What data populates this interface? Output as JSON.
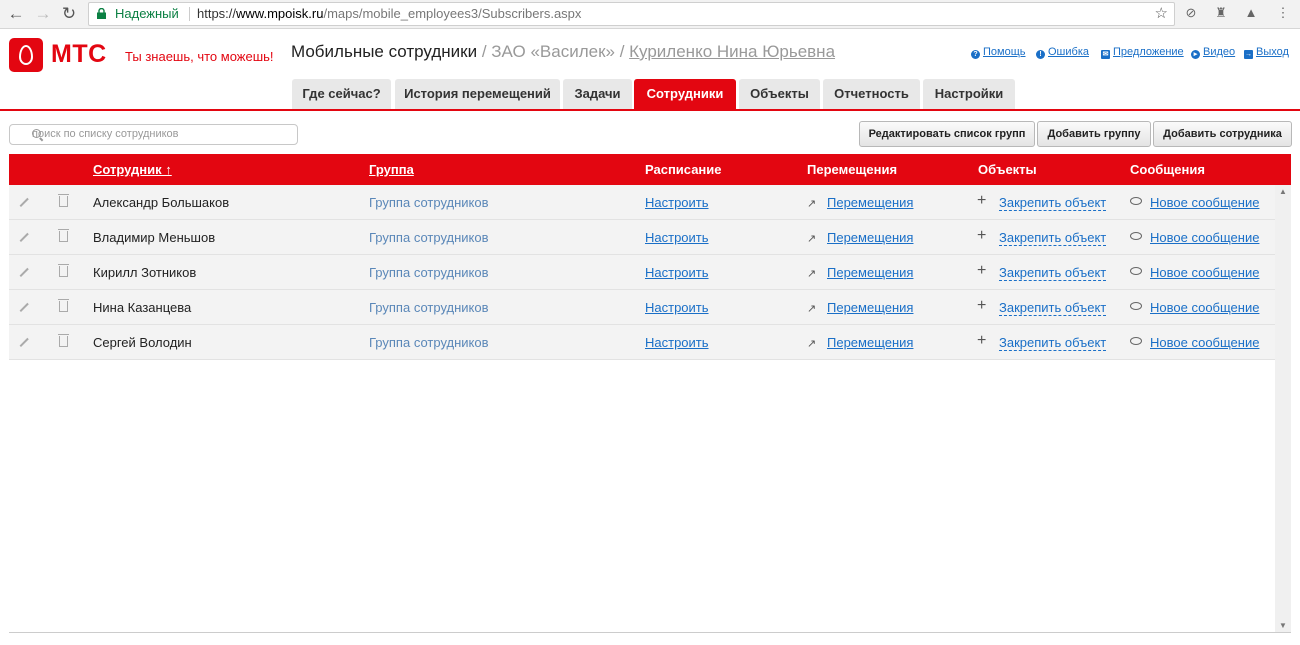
{
  "browser": {
    "secure_label": "Надежный",
    "url_scheme": "https://",
    "url_host": "www.mpoisk.ru",
    "url_path": "/maps/mobile_employees3/Subscribers.aspx"
  },
  "header": {
    "brand": "МТС",
    "slogan": "Ты знаешь, что можешь!",
    "app_title": "Мобильные сотрудники",
    "company": " / ЗАО «Василек» / ",
    "user_name": "Куриленко Нина Юрьевна",
    "links": {
      "help": "Помощь",
      "error": "Ошибка",
      "suggestion": "Предложение",
      "video": "Видео",
      "logout": "Выход"
    }
  },
  "tabs": [
    {
      "label": "Где сейчас?",
      "active": false
    },
    {
      "label": "История перемещений",
      "active": false
    },
    {
      "label": "Задачи",
      "active": false
    },
    {
      "label": "Сотрудники",
      "active": true
    },
    {
      "label": "Объекты",
      "active": false
    },
    {
      "label": "Отчетность",
      "active": false
    },
    {
      "label": "Настройки",
      "active": false
    }
  ],
  "toolbar": {
    "search_placeholder": "поиск по списку сотрудников",
    "edit_groups": "Редактировать список групп",
    "add_group": "Добавить группу",
    "add_employee": "Добавить сотрудника"
  },
  "grid": {
    "columns": {
      "employee": "Сотрудник ↑",
      "group": "Группа",
      "schedule": "Расписание",
      "movements": "Перемещения",
      "objects": "Объекты",
      "messages": "Сообщения"
    },
    "rows": [
      {
        "name": "Александр Большаков",
        "group": "Группа сотрудников",
        "schedule": "Настроить",
        "movements": "Перемещения",
        "objects": "Закрепить объект",
        "messages": "Новое сообщение"
      },
      {
        "name": "Владимир Меньшов",
        "group": "Группа сотрудников",
        "schedule": "Настроить",
        "movements": "Перемещения",
        "objects": "Закрепить объект",
        "messages": "Новое сообщение"
      },
      {
        "name": "Кирилл Зотников",
        "group": "Группа сотрудников",
        "schedule": "Настроить",
        "movements": "Перемещения",
        "objects": "Закрепить объект",
        "messages": "Новое сообщение"
      },
      {
        "name": "Нина Казанцева",
        "group": "Группа сотрудников",
        "schedule": "Настроить",
        "movements": "Перемещения",
        "objects": "Закрепить объект",
        "messages": "Новое сообщение"
      },
      {
        "name": "Сергей Володин",
        "group": "Группа сотрудников",
        "schedule": "Настроить",
        "movements": "Перемещения",
        "objects": "Закрепить объект",
        "messages": "Новое сообщение"
      }
    ]
  },
  "colors": {
    "brand_red": "#e30611",
    "link_blue": "#1a6fc7",
    "secure_green": "#0b8043"
  }
}
